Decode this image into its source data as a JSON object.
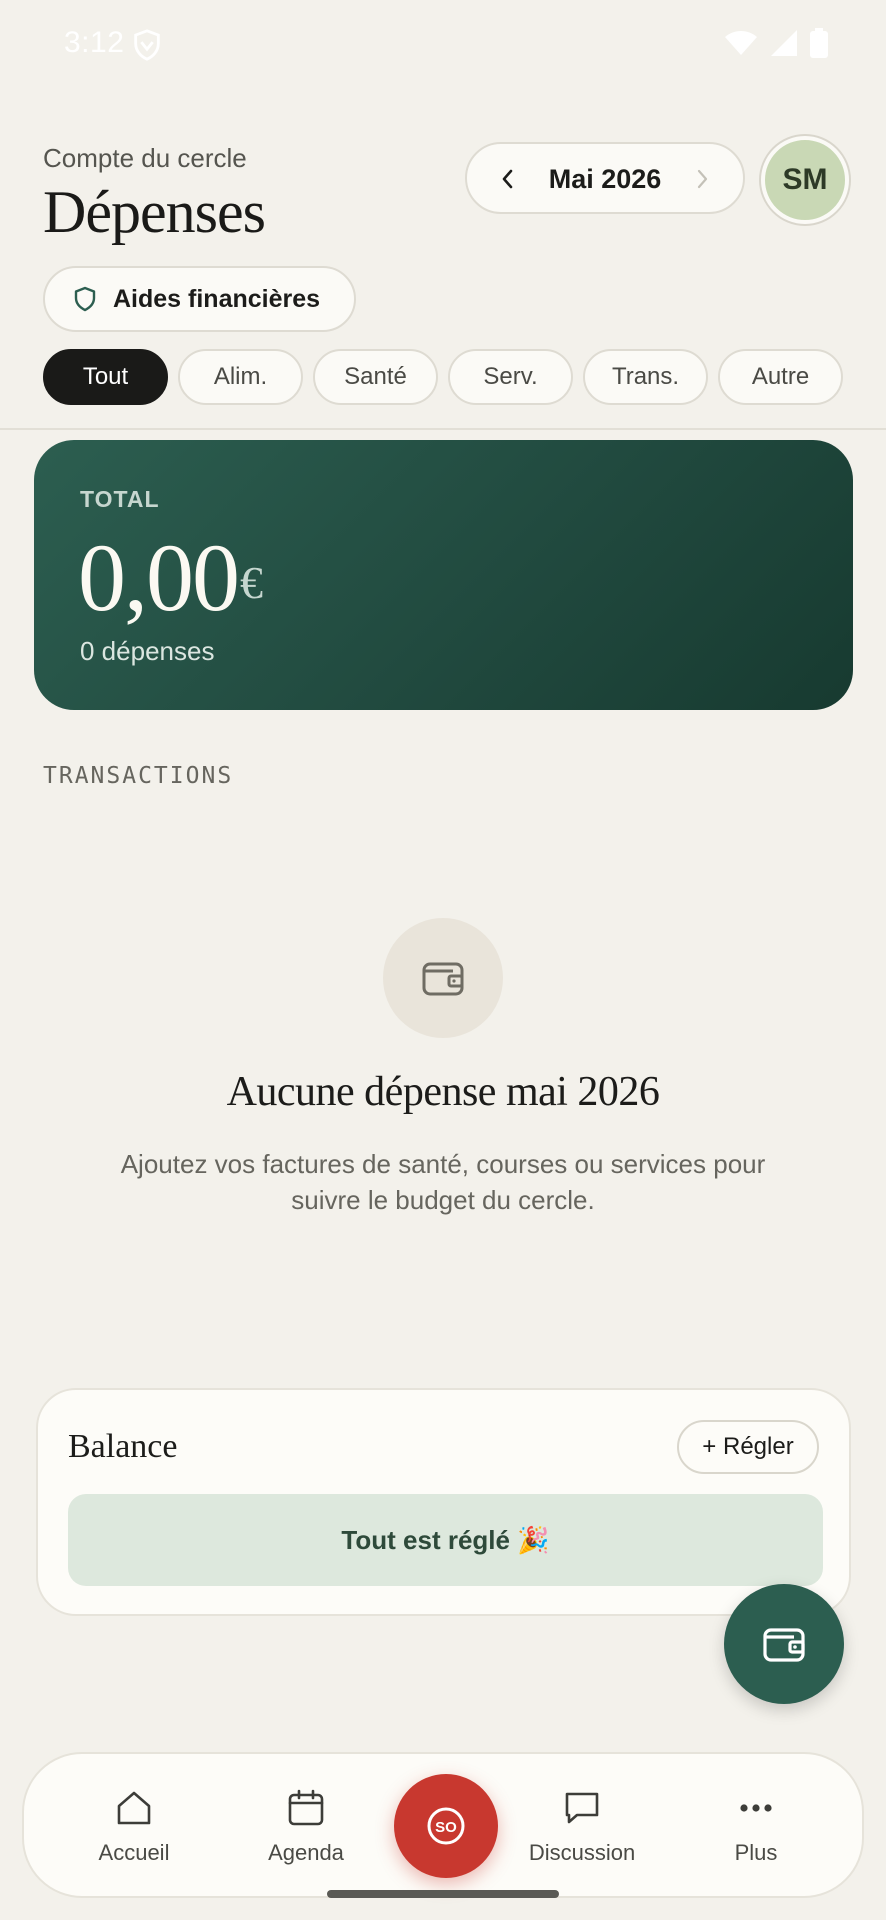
{
  "status_bar": {
    "time": "3:12"
  },
  "header": {
    "subtitle": "Compte du cercle",
    "title": "Dépenses",
    "month": "Mai 2026",
    "avatar_initials": "SM",
    "aid_label": "Aides financières"
  },
  "filters": [
    {
      "label": "Tout",
      "active": true
    },
    {
      "label": "Alim.",
      "active": false
    },
    {
      "label": "Santé",
      "active": false
    },
    {
      "label": "Serv.",
      "active": false
    },
    {
      "label": "Trans.",
      "active": false
    },
    {
      "label": "Autre",
      "active": false
    }
  ],
  "total": {
    "label": "TOTAL",
    "amount": "0,00",
    "currency": "€",
    "count": "0 dépenses"
  },
  "transactions": {
    "section_title": "TRANSACTIONS",
    "empty_title": "Aucune dépense mai 2026",
    "empty_description": "Ajoutez vos factures de santé, courses ou services pour suivre le budget du cercle."
  },
  "balance": {
    "title": "Balance",
    "settle_label": "+ Régler",
    "settled_text": "Tout est réglé 🎉"
  },
  "nav": {
    "items": [
      {
        "label": "Accueil",
        "icon": "home-icon"
      },
      {
        "label": "Agenda",
        "icon": "calendar-icon"
      },
      {
        "label": "Discussion",
        "icon": "chat-icon"
      },
      {
        "label": "Plus",
        "icon": "more-icon"
      }
    ],
    "center_icon": "sos-icon"
  },
  "colors": {
    "accent_green": "#2c5e50",
    "sos_red": "#c8382f",
    "background": "#f3f1eb"
  }
}
